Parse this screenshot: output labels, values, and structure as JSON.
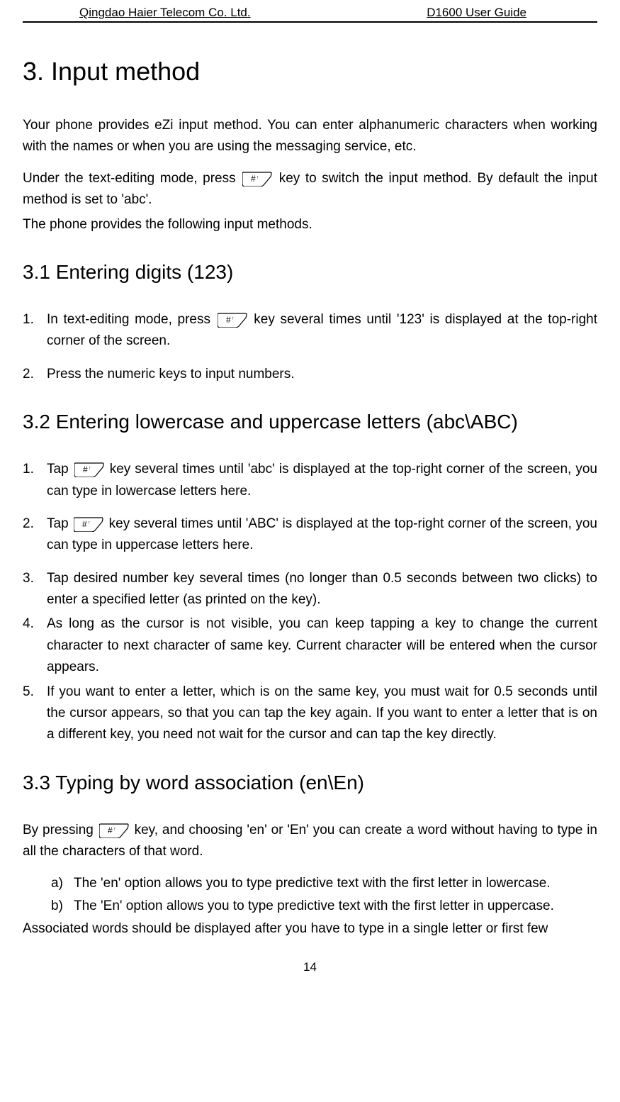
{
  "header": {
    "left": "Qingdao Haier Telecom Co. Ltd.",
    "right": "D1600 User Guide"
  },
  "title": "3. Input method",
  "intro_p1": "Your phone provides eZi input method. You can enter alphanumeric characters when working with the names or when you are using the messaging service, etc.",
  "intro_p2a": "Under the text-editing mode, press ",
  "intro_p2b": " key to switch the input method. By default the input method is set to 'abc'.",
  "intro_p3": "The phone provides the following input methods.",
  "sec31": {
    "heading": "3.1 Entering digits (123)",
    "item1a": "In text-editing mode, press ",
    "item1b": " key several times until '123' is displayed at the top-right corner of the screen.",
    "item2": "Press the numeric keys to input numbers."
  },
  "sec32": {
    "heading": "3.2 Entering lowercase and uppercase letters (abc\\ABC)",
    "item1a": "Tap ",
    "item1b": " key several times until 'abc' is displayed at the top-right corner of the screen, you can type in lowercase letters here.",
    "item2a": "Tap ",
    "item2b": " key several times until 'ABC' is displayed at the top-right corner of the screen, you can type in uppercase letters here.",
    "item3": "Tap desired number key several times (no longer than 0.5 seconds between two clicks) to enter a specified letter (as printed on the key).",
    "item4": "As long as the cursor is not visible, you can keep tapping a key to change the current character to next character of same key. Current character will be entered when the cursor appears.",
    "item5": "If you want to enter a letter, which is on the same key, you must wait for 0.5 seconds until the cursor appears, so that you can tap the key again. If you want to enter a letter that is on a different key, you need not wait for the cursor and can tap the key directly."
  },
  "sec33": {
    "heading": "3.3 Typing by word association (en\\En)",
    "p1a": "By pressing ",
    "p1b": " key, and choosing 'en' or 'En' you can create a word without having to type in all the characters of that word.",
    "itema": "The 'en' option allows you to type predictive text with the first letter in lowercase.",
    "itemb": "The 'En' option allows you to type predictive text with the first letter in uppercase.",
    "p2": "Associated words should be displayed after you have to type in a single letter or first few"
  },
  "page_number": "14"
}
